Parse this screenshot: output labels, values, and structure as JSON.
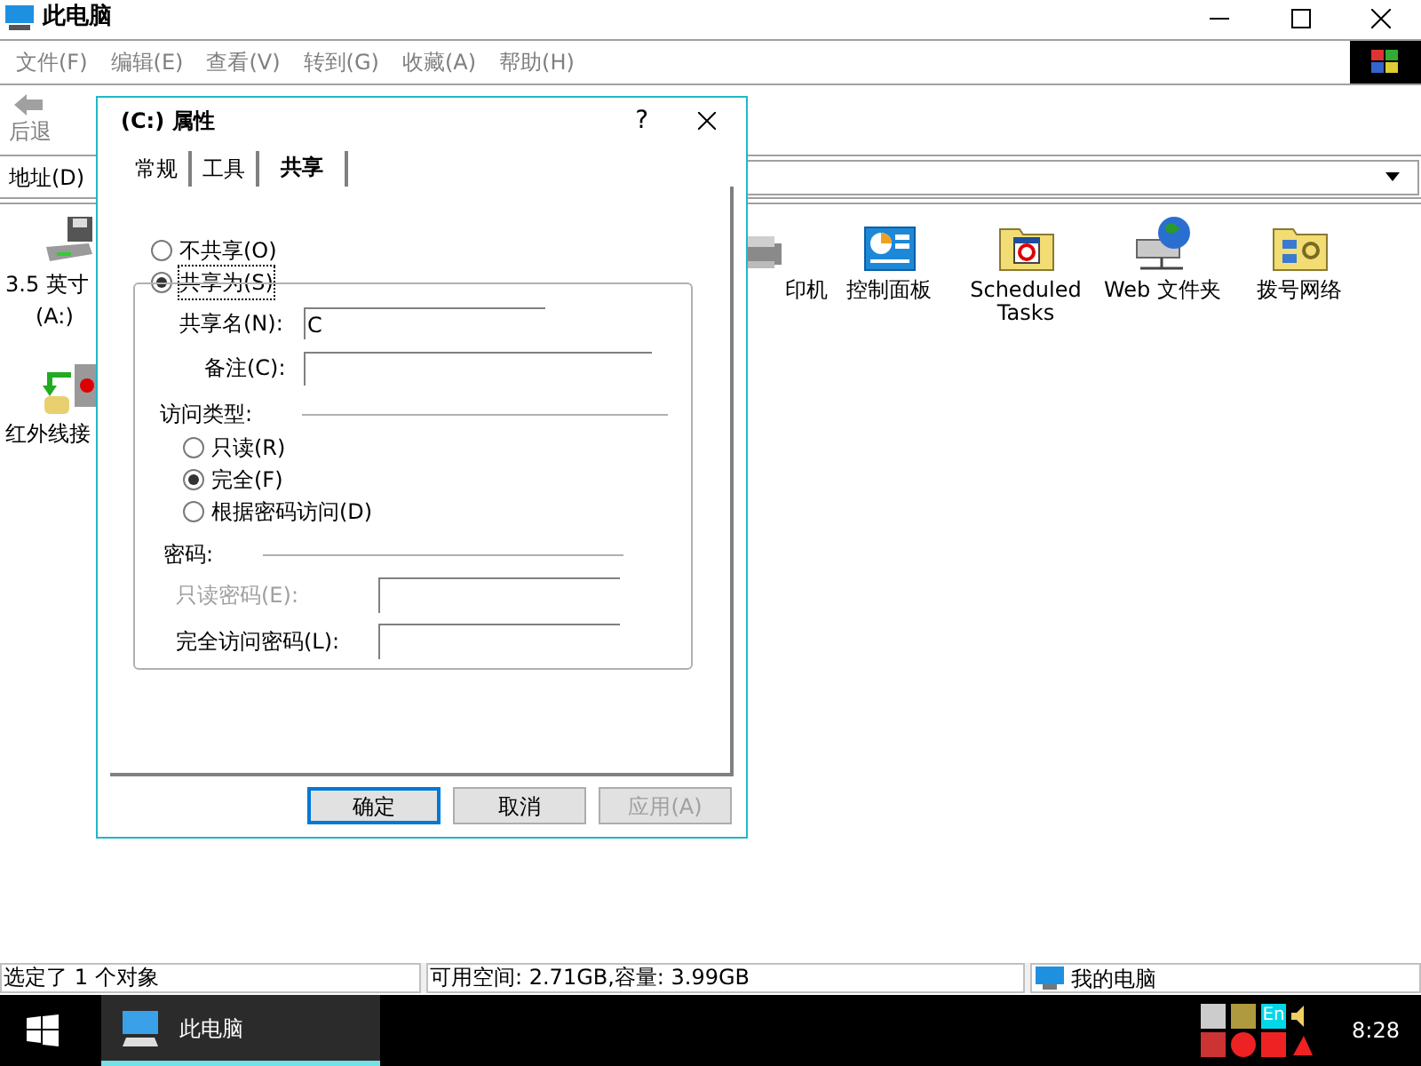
{
  "window": {
    "title": "此电脑"
  },
  "menu": [
    "文件(F)",
    "编辑(E)",
    "查看(V)",
    "转到(G)",
    "收藏(A)",
    "帮助(H)"
  ],
  "toolbar": {
    "back_label": "后退"
  },
  "address": {
    "label": "地址(D)"
  },
  "left_icons": [
    {
      "kind": "floppy",
      "label": "3.5 英寸",
      "sublabel": "(A:)"
    },
    {
      "kind": "infrared",
      "label": "红外线接"
    }
  ],
  "icons": [
    {
      "kind": "printer",
      "label": "印机"
    },
    {
      "kind": "control-panel",
      "label": "控制面板"
    },
    {
      "kind": "scheduled",
      "label": "Scheduled Tasks"
    },
    {
      "kind": "web-folder",
      "label": "Web 文件夹"
    },
    {
      "kind": "dialup",
      "label": "拨号网络"
    }
  ],
  "dialog": {
    "title": "(C:) 属性",
    "help": "?",
    "tabs": [
      {
        "label": "常规",
        "selected": false
      },
      {
        "label": "工具",
        "selected": false
      },
      {
        "label": "共享",
        "selected": true
      }
    ],
    "share_options": [
      {
        "label": "不共享(O)",
        "selected": false
      },
      {
        "label": "共享为(S)",
        "selected": true
      }
    ],
    "share_name": {
      "label": "共享名(N):",
      "value": "C"
    },
    "comment": {
      "label": "备注(C):"
    },
    "access_type": {
      "label": "访问类型:",
      "options": [
        {
          "label": "只读(R)",
          "selected": false
        },
        {
          "label": "完全(F)",
          "selected": true
        },
        {
          "label": "根据密码访问(D)",
          "selected": false
        }
      ]
    },
    "password": {
      "label": "密码:",
      "fields": [
        {
          "label": "只读密码(E):",
          "disabled": true
        },
        {
          "label": "完全访问密码(L):",
          "disabled": false
        }
      ]
    },
    "buttons": [
      {
        "label": "确定",
        "default": true,
        "disabled": false
      },
      {
        "label": "取消",
        "default": false,
        "disabled": false
      },
      {
        "label": "应用(A)",
        "default": false,
        "disabled": true
      }
    ]
  },
  "status_bar": [
    "选定了 1 个对象",
    "可用空间: 2.71GB,容量: 3.99GB",
    "我的电脑"
  ],
  "taskbar": {
    "task": "此电脑",
    "language": "En",
    "clock": "8:28"
  }
}
